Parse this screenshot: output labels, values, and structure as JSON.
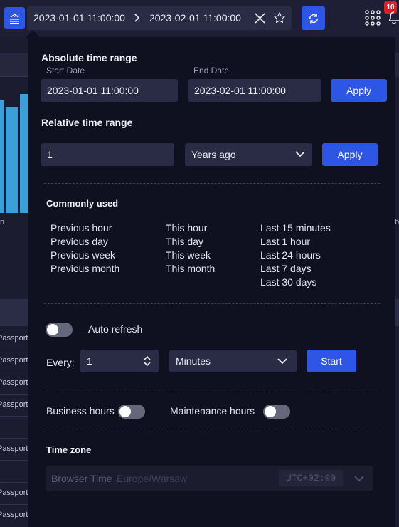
{
  "topbar": {
    "range_start": "2023-01-01 11:00:00",
    "range_end": "2023-02-01 11:00:00",
    "notification_count": "10"
  },
  "background": {
    "chart_axis_left": "n",
    "chart_axis_right": "b",
    "row_label": "Passport"
  },
  "absolute": {
    "title": "Absolute time range",
    "start_label": "Start Date",
    "start_value": "2023-01-01 11:00:00",
    "end_label": "End Date",
    "end_value": "2023-02-01 11:00:00",
    "apply_label": "Apply"
  },
  "relative": {
    "title": "Relative time range",
    "amount_value": "1",
    "unit_value": "Years ago",
    "apply_label": "Apply"
  },
  "common": {
    "title": "Commonly used",
    "col1": [
      "Previous hour",
      "Previous day",
      "Previous week",
      "Previous month"
    ],
    "col2": [
      "This hour",
      "This day",
      "This week",
      "This month"
    ],
    "col3": [
      "Last 15 minutes",
      "Last 1 hour",
      "Last 24 hours",
      "Last 7 days",
      "Last 30 days"
    ]
  },
  "auto_refresh": {
    "toggle_label": "Auto refresh",
    "enabled": false,
    "every_label": "Every:",
    "interval_value": "1",
    "unit_value": "Minutes",
    "start_label": "Start"
  },
  "hours": {
    "business_label": "Business hours",
    "business_enabled": false,
    "maintenance_label": "Maintenance hours",
    "maintenance_enabled": false
  },
  "timezone": {
    "title": "Time zone",
    "value": "Browser Time",
    "detail": "Europe/Warsaw",
    "offset": "UTC+02:00"
  },
  "colors": {
    "accent": "#2d55e6",
    "panel_bg": "#0f1020",
    "field_bg": "#2a2b45",
    "badge": "#e11b23",
    "bar": "#3aa0db"
  }
}
